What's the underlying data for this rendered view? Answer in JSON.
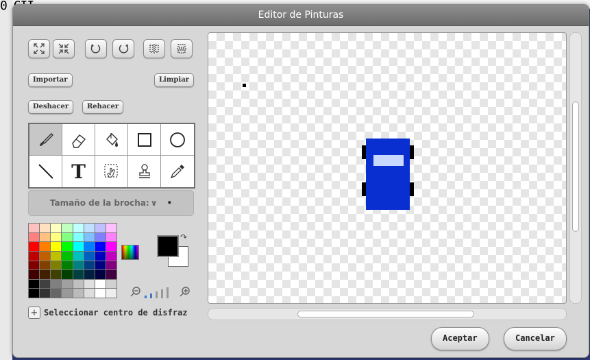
{
  "background": {
    "corner_text": "0 CII"
  },
  "dialog": {
    "title": "Editor de Pinturas",
    "buttons": {
      "import": "Importar",
      "clear": "Limpiar",
      "undo": "Deshacer",
      "redo": "Rehacer",
      "ok": "Aceptar",
      "cancel": "Cancelar"
    },
    "transform_icons": [
      "grow-icon",
      "shrink-icon",
      "rotate-left-icon",
      "rotate-right-icon",
      "flip-horizontal-icon",
      "flip-vertical-icon"
    ],
    "tools": [
      "paintbrush-icon",
      "eraser-icon",
      "fill-bucket-icon",
      "rectangle-icon",
      "ellipse-icon",
      "line-icon",
      "text-icon",
      "select-icon",
      "stamp-icon",
      "eyedropper-icon"
    ],
    "active_tool": "paintbrush-icon",
    "text_tool_glyph": "T",
    "brush_size_label": "Tamaño de la brocha:",
    "brush_chevron": "∨",
    "brush_dot": "•",
    "set_center_label": "Seleccionar centro de disfraz",
    "plus_label": "+",
    "foreground_color": "#000000",
    "background_color": "#ffffff"
  },
  "palette": [
    "#ffc0c0",
    "#ffe0c0",
    "#ffffc0",
    "#c0ffc0",
    "#c0ffff",
    "#c0e0ff",
    "#c0c0ff",
    "#ffc0ff",
    "#ff8080",
    "#ffc080",
    "#ffff80",
    "#80ff80",
    "#80ffff",
    "#80c0ff",
    "#8080ff",
    "#ff80ff",
    "#ff0000",
    "#ff8000",
    "#ffff00",
    "#00ff00",
    "#00ffff",
    "#0080ff",
    "#0000ff",
    "#ff00ff",
    "#c00000",
    "#c06000",
    "#c0c000",
    "#00c000",
    "#00c0c0",
    "#0060c0",
    "#0000c0",
    "#c000c0",
    "#800000",
    "#804000",
    "#808000",
    "#008000",
    "#008080",
    "#004080",
    "#000080",
    "#800080",
    "#400000",
    "#402000",
    "#404000",
    "#004000",
    "#004040",
    "#002040",
    "#000040",
    "#400040",
    "#000000",
    "#404040",
    "#808080",
    "#a0a0a0",
    "#c0c0c0",
    "#e0e0e0",
    "#ffffff",
    "#d0d0d0",
    "#000000",
    "#333333",
    "#666666",
    "#999999",
    "#bbbbbb",
    "#dddddd",
    "#ffffff",
    "#eeeeee"
  ],
  "sprite_colors": {
    "body": "#0a2fd0",
    "window": "#c8d8ff",
    "wheels": "#000000"
  }
}
